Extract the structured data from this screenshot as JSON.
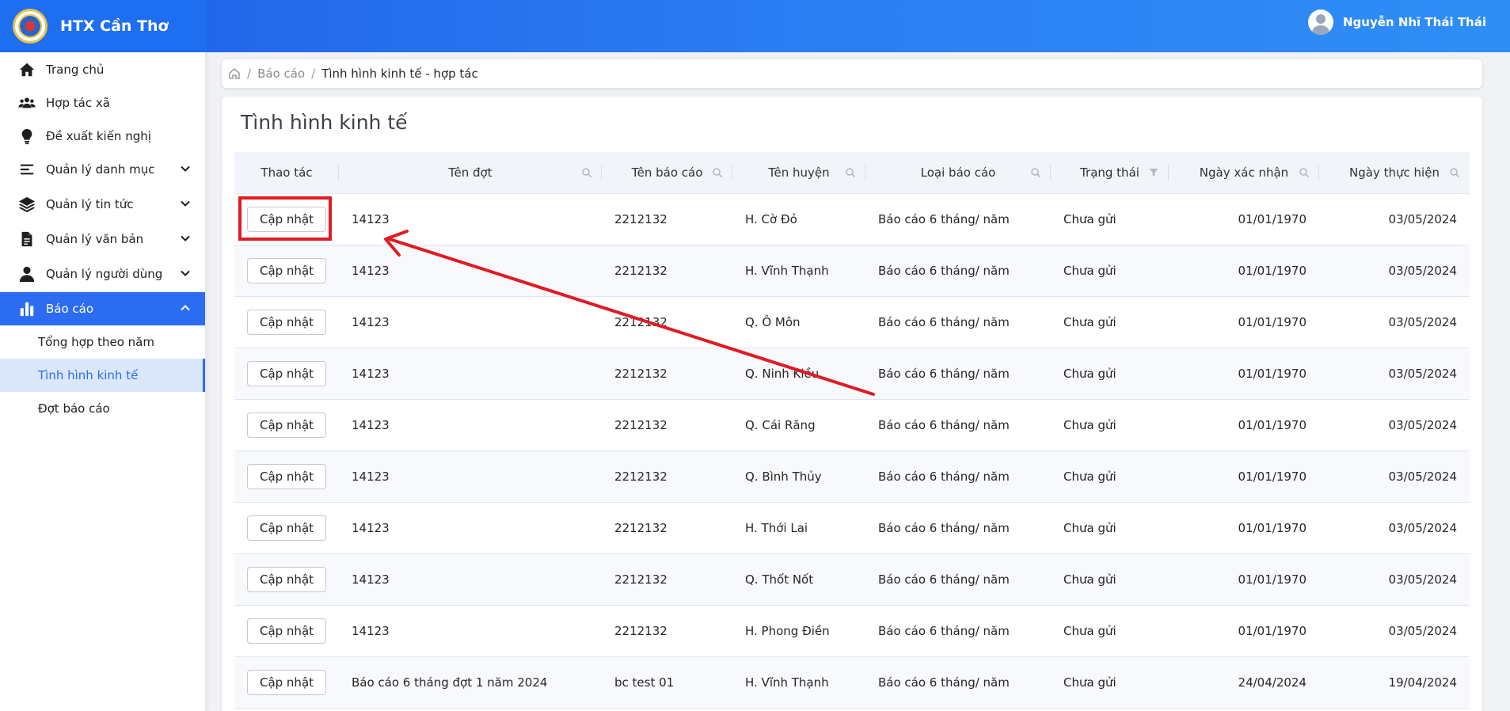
{
  "app": {
    "name": "HTX Cần Thơ"
  },
  "user": {
    "name": "Nguyễn Nhĩ Thái Thái"
  },
  "sidebar": {
    "items": [
      {
        "label": "Trang chủ"
      },
      {
        "label": "Hợp tác xã"
      },
      {
        "label": "Đề xuất kiến nghị"
      },
      {
        "label": "Quản lý danh mục"
      },
      {
        "label": "Quản lý tin tức"
      },
      {
        "label": "Quản lý văn bản"
      },
      {
        "label": "Quản lý người dùng"
      },
      {
        "label": "Báo cáo"
      }
    ],
    "sub_items": [
      {
        "label": "Tổng hợp theo năm"
      },
      {
        "label": "Tình hình kinh tế"
      },
      {
        "label": "Đợt báo cáo"
      }
    ]
  },
  "breadcrumb": {
    "parent": "Báo cáo",
    "current": "Tình hình kinh tế - hợp tác"
  },
  "page": {
    "title": "Tình hình kinh tế"
  },
  "table": {
    "columns": [
      "Thao tác",
      "Tên đợt",
      "Tên báo cáo",
      "Tên huyện",
      "Loại báo cáo",
      "Trạng thái",
      "Ngày xác nhận",
      "Ngày thực hiện"
    ],
    "action_label": "Cập nhật",
    "rows": [
      [
        "14123",
        "2212132",
        "H. Cờ Đỏ",
        "Báo cáo 6 tháng/ năm",
        "Chưa gửi",
        "01/01/1970",
        "03/05/2024"
      ],
      [
        "14123",
        "2212132",
        "H. Vĩnh Thạnh",
        "Báo cáo 6 tháng/ năm",
        "Chưa gửi",
        "01/01/1970",
        "03/05/2024"
      ],
      [
        "14123",
        "2212132",
        "Q. Ô Môn",
        "Báo cáo 6 tháng/ năm",
        "Chưa gửi",
        "01/01/1970",
        "03/05/2024"
      ],
      [
        "14123",
        "2212132",
        "Q. Ninh Kiều",
        "Báo cáo 6 tháng/ năm",
        "Chưa gửi",
        "01/01/1970",
        "03/05/2024"
      ],
      [
        "14123",
        "2212132",
        "Q. Cái Răng",
        "Báo cáo 6 tháng/ năm",
        "Chưa gửi",
        "01/01/1970",
        "03/05/2024"
      ],
      [
        "14123",
        "2212132",
        "Q. Bình Thủy",
        "Báo cáo 6 tháng/ năm",
        "Chưa gửi",
        "01/01/1970",
        "03/05/2024"
      ],
      [
        "14123",
        "2212132",
        "H. Thới Lai",
        "Báo cáo 6 tháng/ năm",
        "Chưa gửi",
        "01/01/1970",
        "03/05/2024"
      ],
      [
        "14123",
        "2212132",
        "Q. Thốt Nốt",
        "Báo cáo 6 tháng/ năm",
        "Chưa gửi",
        "01/01/1970",
        "03/05/2024"
      ],
      [
        "14123",
        "2212132",
        "H. Phong Điền",
        "Báo cáo 6 tháng/ năm",
        "Chưa gửi",
        "01/01/1970",
        "03/05/2024"
      ],
      [
        "Báo cáo 6 tháng đợt 1 năm 2024",
        "bc test 01",
        "H. Vĩnh Thạnh",
        "Báo cáo 6 tháng/ năm",
        "Chưa gửi",
        "24/04/2024",
        "19/04/2024"
      ]
    ]
  },
  "colors": {
    "primary": "#2b6cf0",
    "annotation": "#e01b24"
  }
}
